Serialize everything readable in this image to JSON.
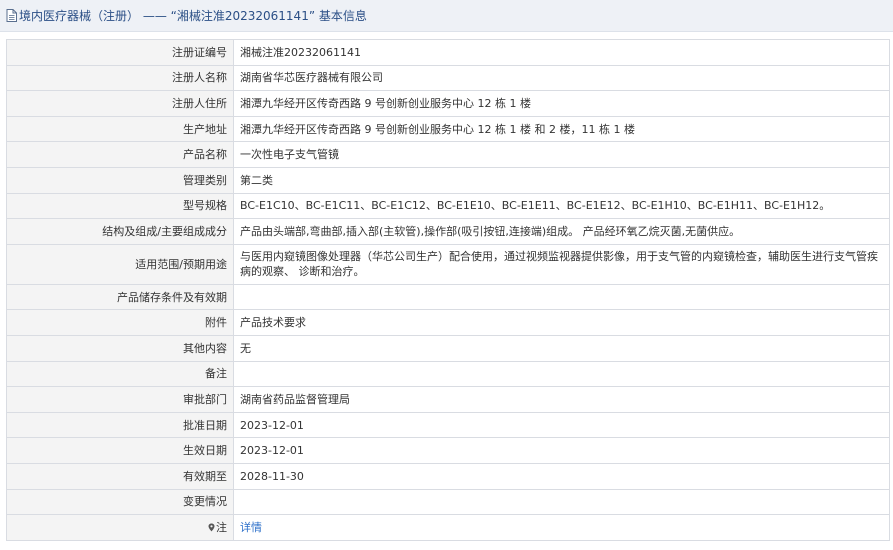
{
  "header": {
    "title": "境内医疗器械（注册） —— “湘械注准20232061141” 基本信息"
  },
  "rows": [
    {
      "label": "注册证编号",
      "value": "湘械注准20232061141"
    },
    {
      "label": "注册人名称",
      "value": "湖南省华芯医疗器械有限公司"
    },
    {
      "label": "注册人住所",
      "value": "湘潭九华经开区传奇西路 9 号创新创业服务中心 12 栋 1 楼"
    },
    {
      "label": "生产地址",
      "value": "湘潭九华经开区传奇西路 9 号创新创业服务中心 12 栋 1 楼 和 2 楼，11 栋 1 楼"
    },
    {
      "label": "产品名称",
      "value": "一次性电子支气管镜"
    },
    {
      "label": "管理类别",
      "value": "第二类"
    },
    {
      "label": "型号规格",
      "value": "BC-E1C10、BC-E1C11、BC-E1C12、BC-E1E10、BC-E1E11、BC-E1E12、BC-E1H10、BC-E1H11、BC-E1H12。"
    },
    {
      "label": "结构及组成/主要组成成分",
      "value": "产品由头端部,弯曲部,插入部(主软管),操作部(吸引按钮,连接端)组成。 产品经环氧乙烷灭菌,无菌供应。"
    },
    {
      "label": "适用范围/预期用途",
      "value": "与医用内窥镜图像处理器（华芯公司生产）配合使用，通过视频监视器提供影像，用于支气管的内窥镜检查，辅助医生进行支气管疾病的观察、 诊断和治疗。"
    },
    {
      "label": "产品储存条件及有效期",
      "value": ""
    },
    {
      "label": "附件",
      "value": "产品技术要求"
    },
    {
      "label": "其他内容",
      "value": "无"
    },
    {
      "label": "备注",
      "value": ""
    },
    {
      "label": "审批部门",
      "value": "湖南省药品监督管理局"
    },
    {
      "label": "批准日期",
      "value": "2023-12-01"
    },
    {
      "label": "生效日期",
      "value": "2023-12-01"
    },
    {
      "label": "有效期至",
      "value": "2028-11-30"
    },
    {
      "label": "变更情况",
      "value": ""
    }
  ],
  "note_row": {
    "label": "注",
    "link": "详情"
  }
}
